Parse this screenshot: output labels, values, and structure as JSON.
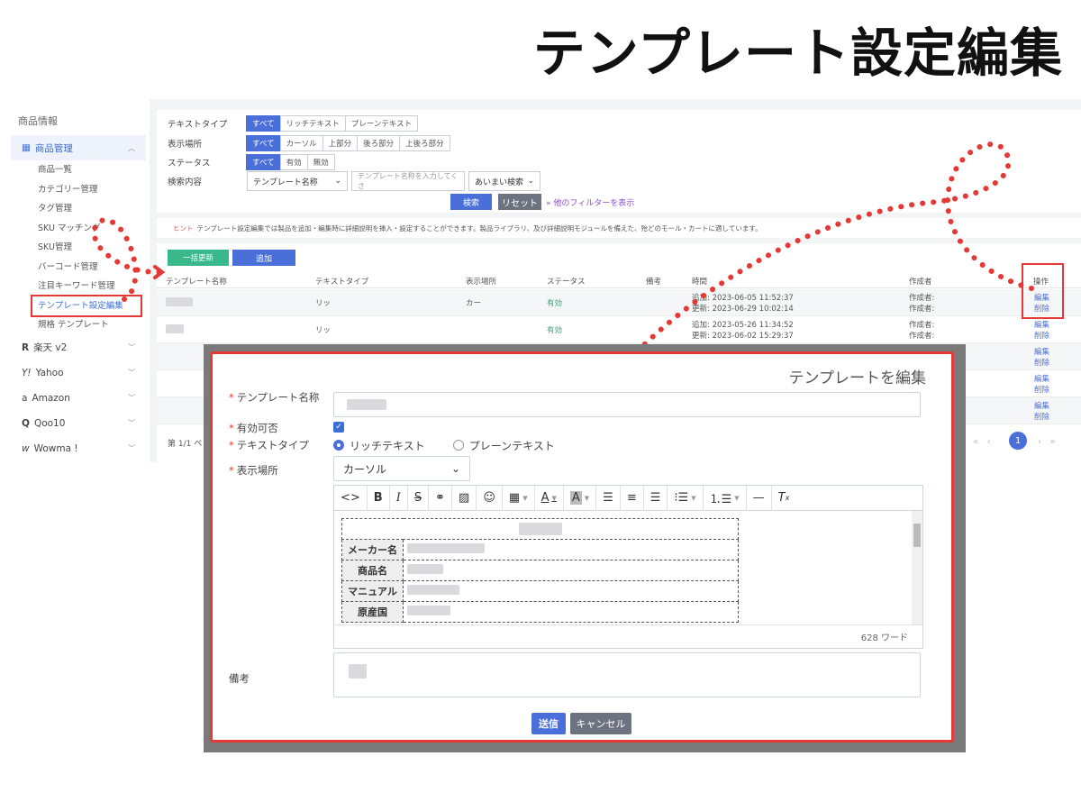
{
  "page_title": "テンプレート設定編集",
  "sidebar": {
    "section": "商品情報",
    "group": "商品管理",
    "items": [
      "商品一覧",
      "カテゴリー管理",
      "タグ管理",
      "SKU マッチング",
      "SKU管理",
      "バーコード管理",
      "注目キーワード管理",
      "テンプレート設定編集",
      "規格 テンプレート"
    ],
    "channels": [
      {
        "icon": "R",
        "label": "楽天 v2"
      },
      {
        "icon": "Y!",
        "label": "Yahoo"
      },
      {
        "icon": "a",
        "label": "Amazon"
      },
      {
        "icon": "Q",
        "label": "Qoo10"
      },
      {
        "icon": "w",
        "label": "Wowma !"
      }
    ]
  },
  "filter": {
    "text_type": {
      "label": "テキストタイプ",
      "options": [
        "すべて",
        "リッチテキスト",
        "プレーンテキスト"
      ]
    },
    "display_place": {
      "label": "表示場所",
      "options": [
        "すべて",
        "カーソル",
        "上部分",
        "後ろ部分",
        "上後ろ部分"
      ]
    },
    "status": {
      "label": "ステータス",
      "options": [
        "すべて",
        "有効",
        "無効"
      ]
    },
    "search": {
      "label": "検索内容",
      "field": "テンプレート名称",
      "placeholder": "テンプレート名称を入力してくさ",
      "mode": "あいまい検索"
    },
    "search_button": "検索",
    "reset_button": "リセット",
    "more_filters": "他のフィルターを表示"
  },
  "hint": {
    "tip": "ヒント",
    "text": "テンプレート設定編集では製品を追加・編集時に詳細説明を挿入・設定することができます。製品ライブラリ、及び詳細説明モジュールを備えた、殆どのモール・カートに適しています。"
  },
  "list": {
    "bulk_update": "一括更新",
    "add": "追加",
    "columns": [
      "テンプレート名称",
      "テキストタイプ",
      "表示場所",
      "ステータス",
      "備考",
      "時間",
      "作成者",
      "操作"
    ],
    "rows": [
      {
        "type": "リッ",
        "place": "カー",
        "status": "有効",
        "time1": "追加: 2023-06-05 11:52:37",
        "time2": "更新: 2023-06-29 10:02:14",
        "creator1": "作成者:",
        "creator2": "作成者:",
        "op_edit": "編集",
        "op_delete": "削除"
      },
      {
        "type": "リッ",
        "place": "",
        "status": "有効",
        "time1": "追加: 2023-05-26 11:34:52",
        "time2": "更新: 2023-06-02 15:29:37",
        "creator1": "作成者:",
        "creator2": "作成者:",
        "op_edit": "編集",
        "op_delete": "削除"
      },
      {
        "op_edit": "編集",
        "op_delete": "削除"
      },
      {
        "op_edit": "編集",
        "op_delete": "削除"
      },
      {
        "op_edit": "編集",
        "op_delete": "削除"
      }
    ],
    "pager_text": "第 1/1 ペ",
    "current_page": "1"
  },
  "modal": {
    "title": "テンプレートを編集",
    "name_label": "テンプレート名称",
    "enabled_label": "有効可否",
    "text_type_label": "テキストタイプ",
    "text_type_options": [
      "リッチテキスト",
      "プレーンテキスト"
    ],
    "place_label": "表示場所",
    "place_value": "カーソル",
    "table_rows": [
      "メーカー名",
      "商品名",
      "マニュアル",
      "原産国"
    ],
    "word_count": "628 ワード",
    "note_label": "備考",
    "submit": "送信",
    "cancel": "キャンセル"
  },
  "colors": {
    "accent": "#4a6fd8",
    "highlight": "#e53935",
    "success": "#39b98a"
  }
}
